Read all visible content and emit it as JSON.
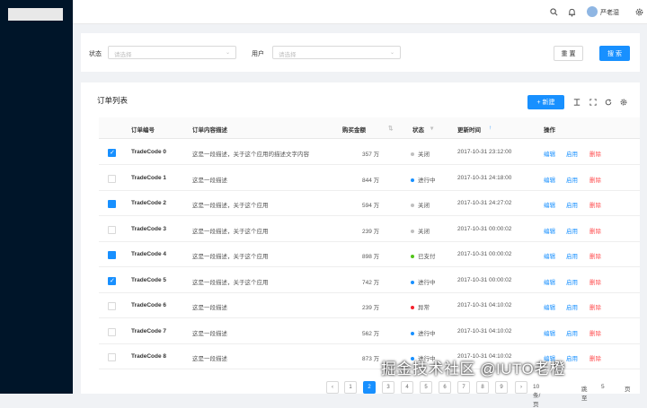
{
  "header": {
    "username": "严老湿",
    "icons": [
      "search-icon",
      "bell-icon",
      "settings-icon"
    ]
  },
  "filters": {
    "status_label": "状态",
    "status_placeholder": "请选择",
    "user_label": "用户",
    "user_placeholder": "请选择",
    "reset_label": "重 置",
    "search_label": "搜 索"
  },
  "table": {
    "title": "订单列表",
    "new_button": "+ 新建",
    "columns": [
      "订单编号",
      "订单内容描述",
      "购买金额",
      "状态",
      "更新时间",
      "操作"
    ],
    "actions": [
      "编辑",
      "启用",
      "删除"
    ],
    "rows": [
      {
        "checked": true,
        "code": "TradeCode 0",
        "desc": "这是一段描述，关于这个应用的描述文字内容",
        "amount": "357 万",
        "status": "关闭",
        "status_color": "#bfbfbf",
        "time": "2017-10-31 23:12:00"
      },
      {
        "checked": false,
        "code": "TradeCode 1",
        "desc": "这是一段描述",
        "amount": "844 万",
        "status": "进行中",
        "status_color": "#1890ff",
        "time": "2017-10-31 24:18:00"
      },
      {
        "checked": true,
        "code": "TradeCode 2",
        "desc": "这是一段描述，关于这个应用",
        "amount": "594 万",
        "status": "关闭",
        "status_color": "#bfbfbf",
        "time": "2017-10-31 24:27:02"
      },
      {
        "checked": false,
        "code": "TradeCode 3",
        "desc": "这是一段描述，关于这个应用",
        "amount": "239 万",
        "status": "关闭",
        "status_color": "#bfbfbf",
        "time": "2017-10-31 00:00:02"
      },
      {
        "checked": true,
        "code": "TradeCode 4",
        "desc": "这是一段描述，关于这个应用",
        "amount": "898 万",
        "status": "已支付",
        "status_color": "#52c41a",
        "time": "2017-10-31 00:00:02"
      },
      {
        "checked": true,
        "code": "TradeCode 5",
        "desc": "这是一段描述，关于这个应用",
        "amount": "742 万",
        "status": "进行中",
        "status_color": "#1890ff",
        "time": "2017-10-31 00:00:02"
      },
      {
        "checked": false,
        "code": "TradeCode 6",
        "desc": "这是一段描述",
        "amount": "239 万",
        "status": "异常",
        "status_color": "#f5222d",
        "time": "2017-10-31 04:10:02"
      },
      {
        "checked": false,
        "code": "TradeCode 7",
        "desc": "这是一段描述",
        "amount": "562 万",
        "status": "进行中",
        "status_color": "#1890ff",
        "time": "2017-10-31 04:10:02"
      },
      {
        "checked": false,
        "code": "TradeCode 8",
        "desc": "这是一段描述",
        "amount": "873 万",
        "status": "进行中",
        "status_color": "#1890ff",
        "time": "2017-10-31 04:10:02"
      }
    ]
  },
  "pagination": {
    "pages": [
      "1",
      "2",
      "3",
      "4",
      "5",
      "6",
      "7",
      "8",
      "9"
    ],
    "active": "2",
    "page_size": "10 条/页",
    "jump_label": "跳至",
    "jump_value": "5",
    "page_suffix": "页"
  },
  "watermark": "掘金技术社区 @IUTO老橙"
}
